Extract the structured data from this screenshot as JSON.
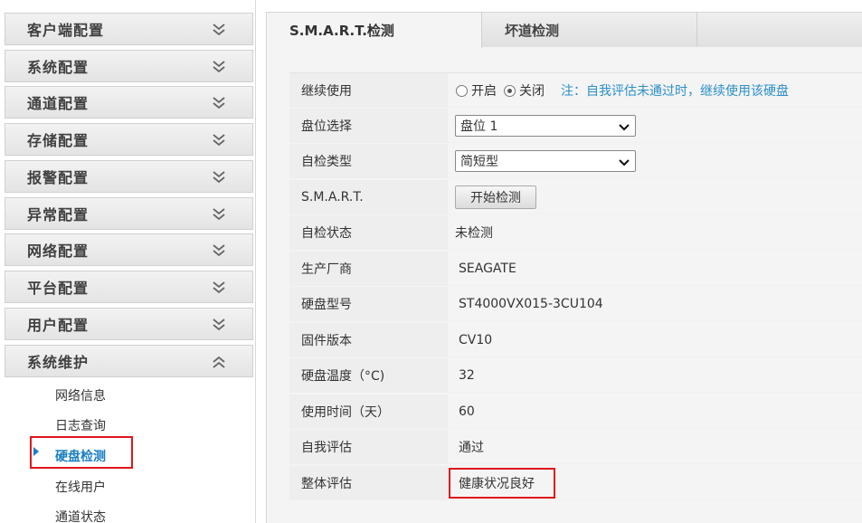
{
  "sidebar": {
    "menus": [
      {
        "label": "客户端配置"
      },
      {
        "label": "系统配置"
      },
      {
        "label": "通道配置"
      },
      {
        "label": "存储配置"
      },
      {
        "label": "报警配置"
      },
      {
        "label": "异常配置"
      },
      {
        "label": "网络配置"
      },
      {
        "label": "平台配置"
      },
      {
        "label": "用户配置"
      },
      {
        "label": "系统维护"
      }
    ],
    "sub_items": [
      {
        "label": "网络信息"
      },
      {
        "label": "日志查询"
      },
      {
        "label": "硬盘检测"
      },
      {
        "label": "在线用户"
      },
      {
        "label": "通道状态"
      }
    ]
  },
  "tabs": [
    {
      "label": "S.M.A.R.T.检测"
    },
    {
      "label": "坏道检测"
    }
  ],
  "form": {
    "continue_use": {
      "label": "继续使用",
      "option_on": "开启",
      "option_off": "关闭",
      "selected": "关闭",
      "note": "注：自我评估未通过时，继续使用该硬盘"
    },
    "disk_select": {
      "label": "盘位选择",
      "value": "盘位 1"
    },
    "test_type": {
      "label": "自检类型",
      "value": "简短型"
    },
    "smart": {
      "label": "S.M.A.R.T.",
      "button": "开始检测"
    },
    "self_test_status": {
      "label": "自检状态",
      "value": "未检测"
    },
    "manufacturer": {
      "label": "生产厂商",
      "value": "SEAGATE"
    },
    "model": {
      "label": "硬盘型号",
      "value": "ST4000VX015-3CU104"
    },
    "firmware": {
      "label": "固件版本",
      "value": "CV10"
    },
    "temperature": {
      "label": "硬盘温度（°C)",
      "value": "32"
    },
    "usage_time": {
      "label": "使用时间（天）",
      "value": "60"
    },
    "self_assessment": {
      "label": "自我评估",
      "value": "通过"
    },
    "overall_assessment": {
      "label": "整体评估",
      "value": "健康状况良好"
    }
  },
  "icons": {
    "menu_collapsed": "double-chevron-down-icon",
    "menu_expanded": "double-chevron-up-icon",
    "active_marker": "triangle-right-icon",
    "dropdown": "chevron-down-icon"
  },
  "colors": {
    "accent": "#1a7fc1",
    "note": "#2b8fc9",
    "highlight_box": "#e0161b"
  }
}
